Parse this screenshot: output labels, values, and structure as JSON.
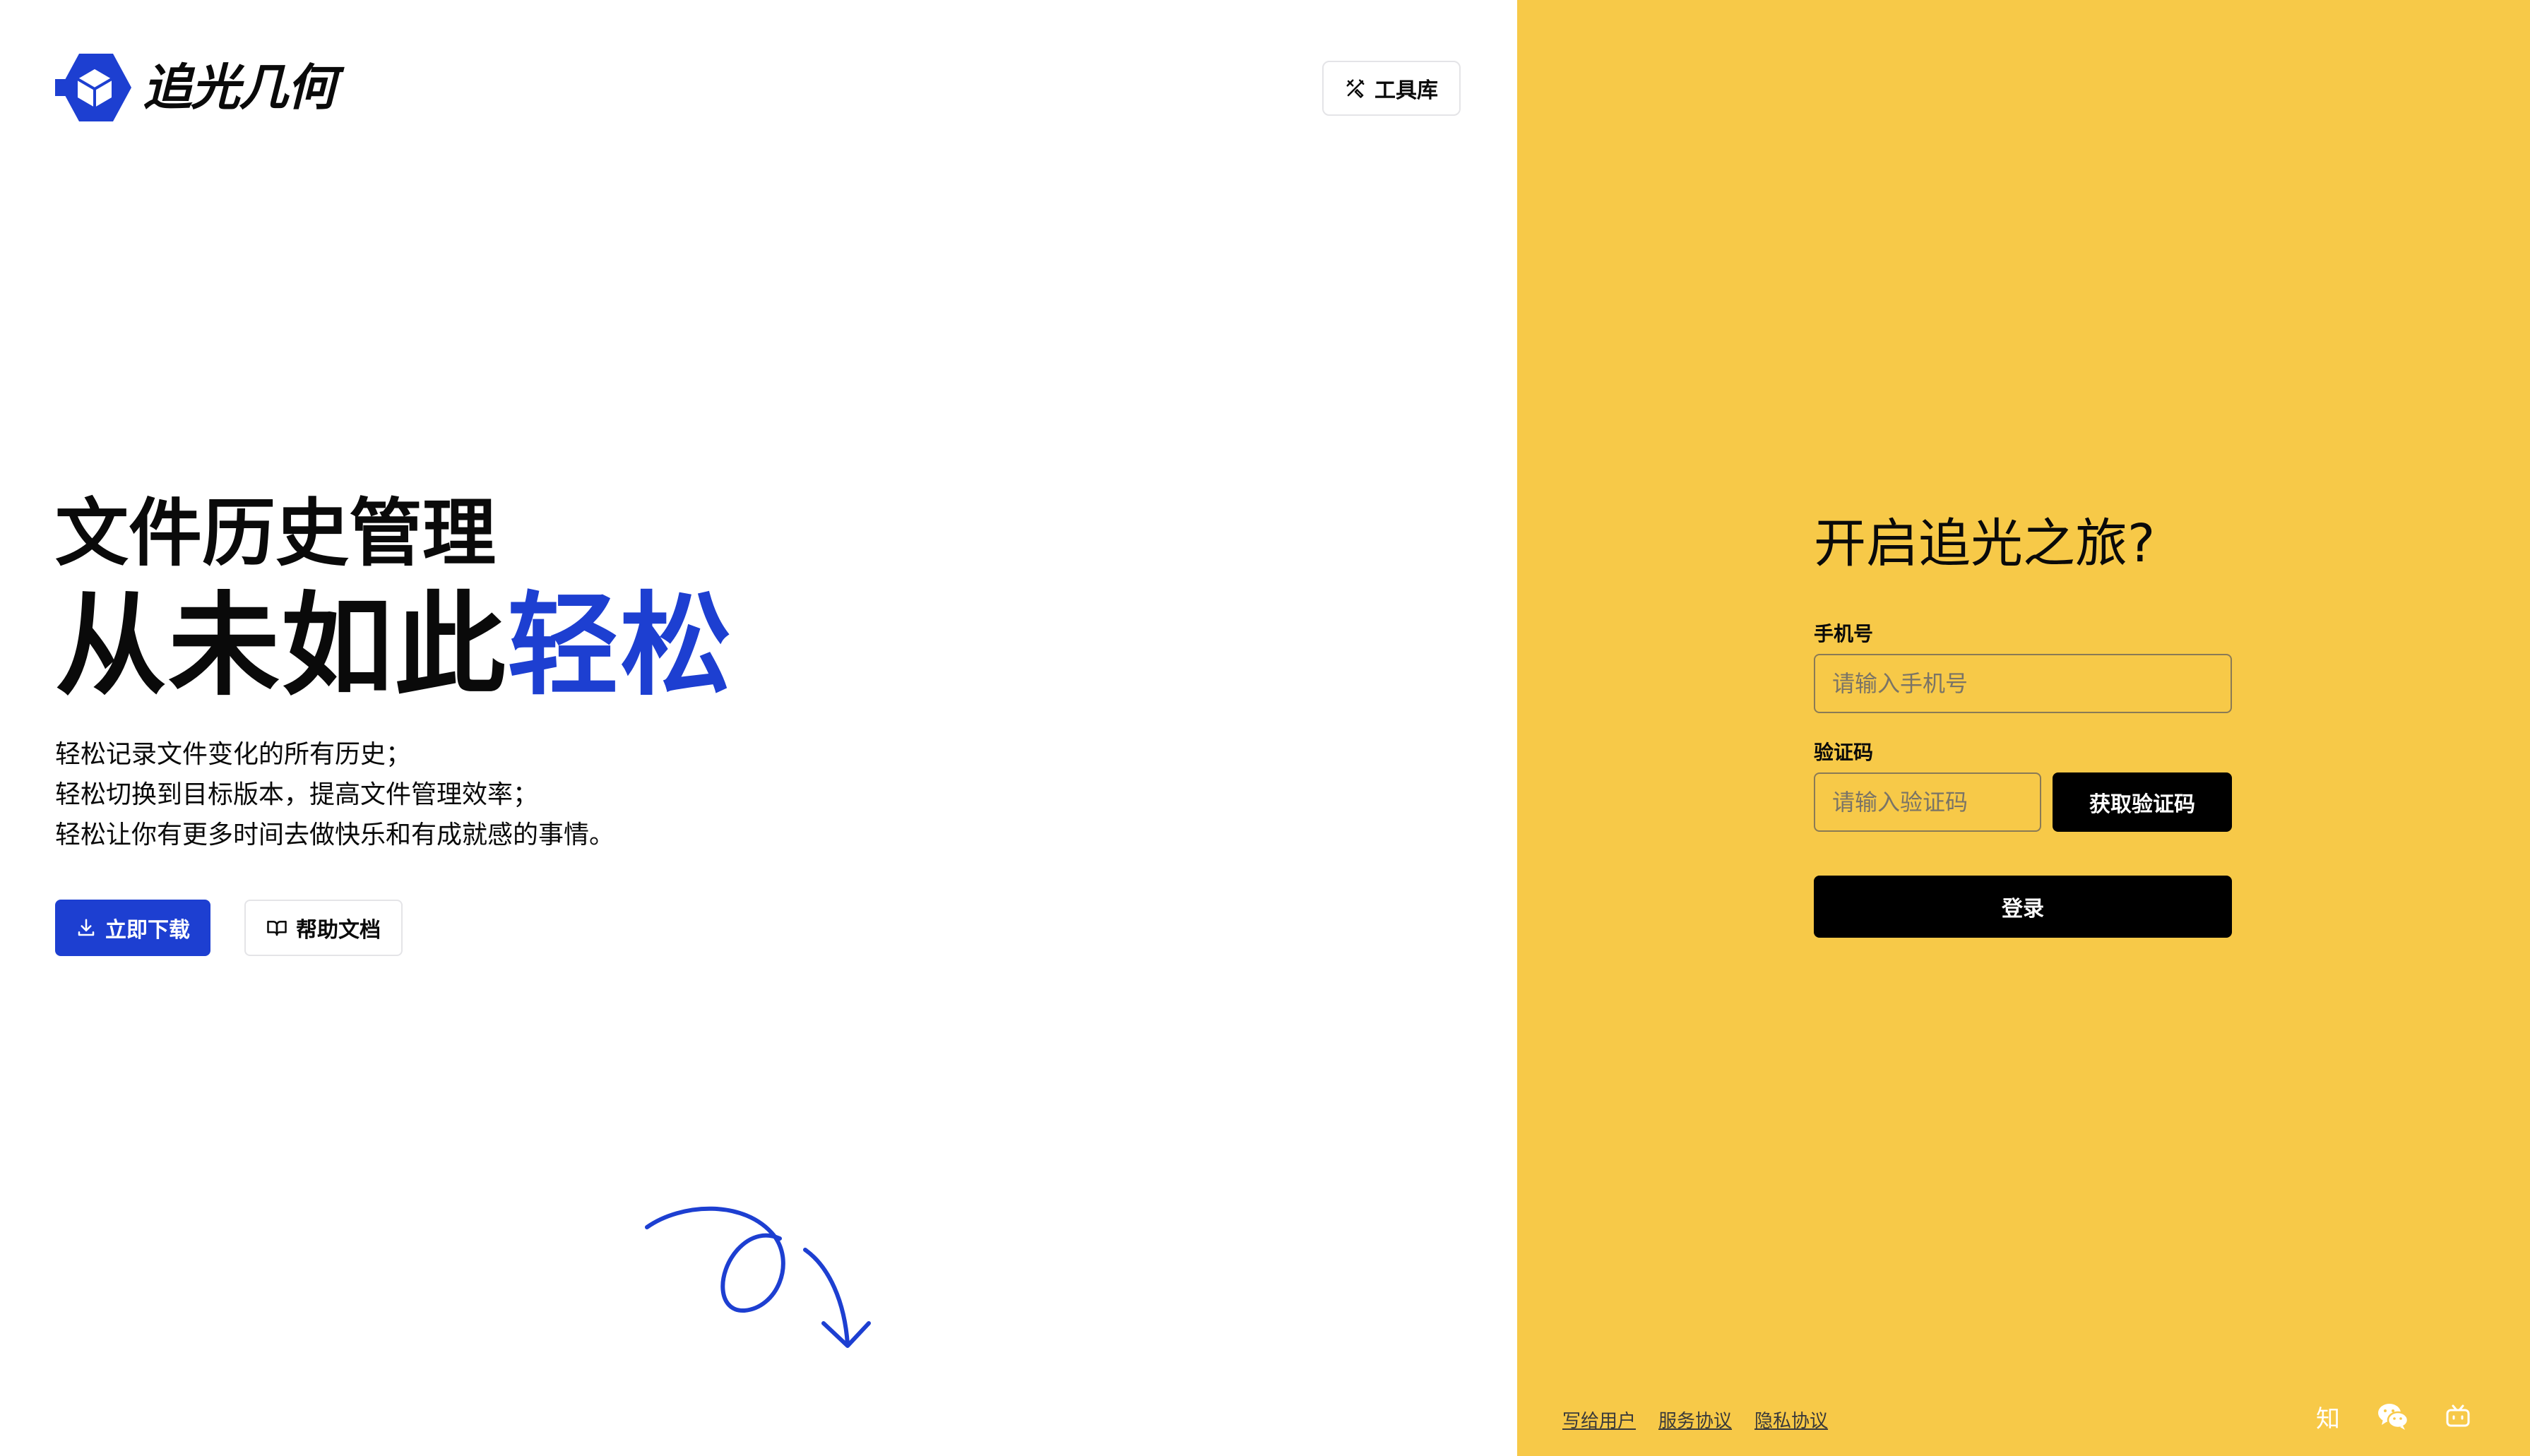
{
  "brand": {
    "name": "追光几何",
    "primary_color": "#1d3fd1",
    "panel_color": "#f7c948"
  },
  "header": {
    "tools_label": "工具库"
  },
  "hero": {
    "subtitle": "文件历史管理",
    "title_main": "从未如此",
    "title_accent": "轻松",
    "lines": [
      "轻松记录文件变化的所有历史；",
      "轻松切换到目标版本，提高文件管理效率；",
      "轻松让你有更多时间去做快乐和有成就感的事情。"
    ],
    "download_label": "立即下载",
    "docs_label": "帮助文档"
  },
  "login": {
    "title": "开启追光之旅?",
    "phone_label": "手机号",
    "phone_placeholder": "请输入手机号",
    "code_label": "验证码",
    "code_placeholder": "请输入验证码",
    "get_code_label": "获取验证码",
    "submit_label": "登录"
  },
  "footer": {
    "links": [
      "写给用户",
      "服务协议",
      "隐私协议"
    ],
    "social": [
      {
        "name": "zhihu-icon",
        "glyph": "知"
      },
      {
        "name": "wechat-icon"
      },
      {
        "name": "bilibili-icon"
      }
    ]
  }
}
